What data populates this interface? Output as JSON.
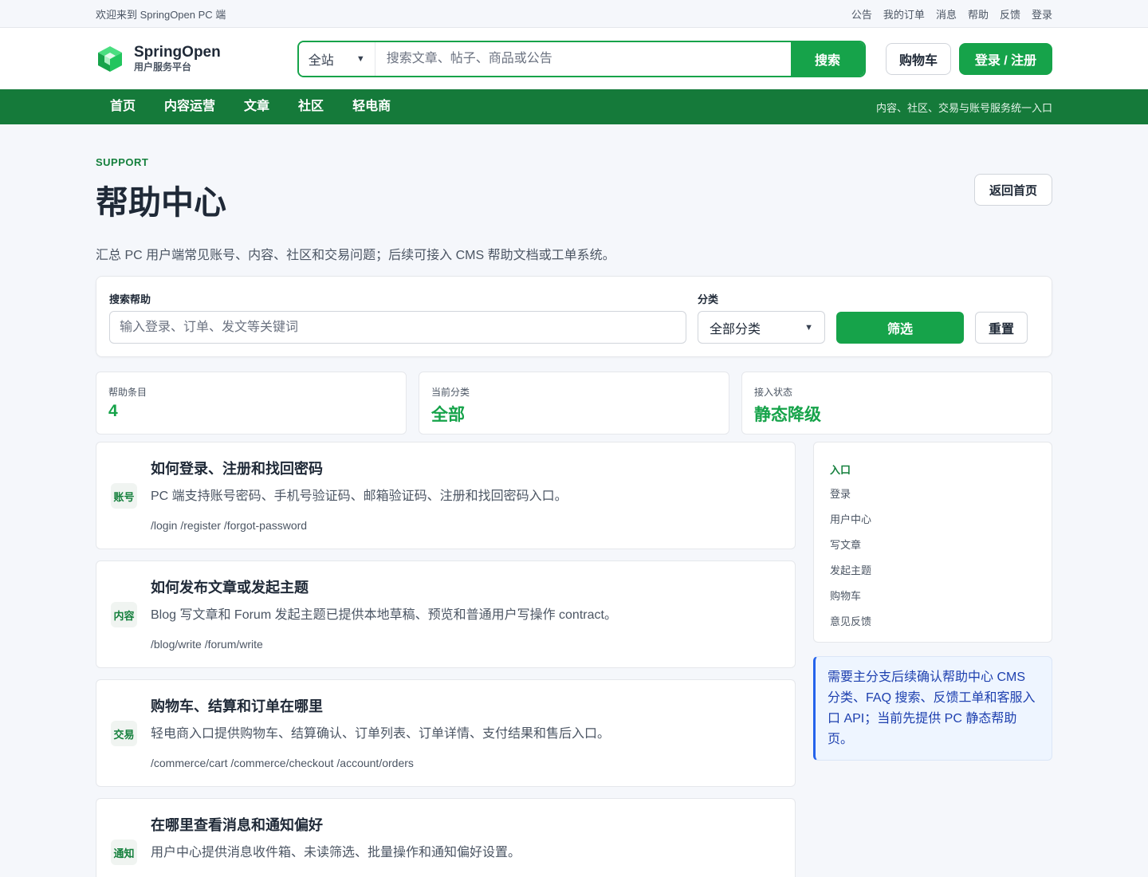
{
  "topbar": {
    "welcome": "欢迎来到 SpringOpen PC 端",
    "links": [
      "公告",
      "我的订单",
      "消息",
      "帮助",
      "反馈",
      "登录"
    ]
  },
  "header": {
    "brand": "SpringOpen",
    "subtitle": "用户服务平台",
    "search_scope": "全站",
    "search_placeholder": "搜索文章、帖子、商品或公告",
    "search_button": "搜索",
    "cart": "购物车",
    "login": "登录 / 注册"
  },
  "nav": {
    "items": [
      "首页",
      "内容运营",
      "文章",
      "社区",
      "轻电商"
    ],
    "slogan": "内容、社区、交易与账号服务统一入口"
  },
  "page": {
    "eyebrow": "SUPPORT",
    "title": "帮助中心",
    "back": "返回首页",
    "desc": "汇总 PC 用户端常见账号、内容、社区和交易问题；后续可接入 CMS 帮助文档或工单系统。"
  },
  "filter": {
    "search_label": "搜索帮助",
    "search_placeholder": "输入登录、订单、发文等关键词",
    "category_label": "分类",
    "category_value": "全部分类",
    "filter_button": "筛选",
    "reset_button": "重置"
  },
  "stats": [
    {
      "label": "帮助条目",
      "value": "4"
    },
    {
      "label": "当前分类",
      "value": "全部"
    },
    {
      "label": "接入状态",
      "value": "静态降级"
    }
  ],
  "items": [
    {
      "badge": "账号",
      "title": "如何登录、注册和找回密码",
      "desc": "PC 端支持账号密码、手机号验证码、邮箱验证码、注册和找回密码入口。",
      "paths": "/login /register /forgot-password"
    },
    {
      "badge": "内容",
      "title": "如何发布文章或发起主题",
      "desc": "Blog 写文章和 Forum 发起主题已提供本地草稿、预览和普通用户写操作 contract。",
      "paths": "/blog/write /forum/write"
    },
    {
      "badge": "交易",
      "title": "购物车、结算和订单在哪里",
      "desc": "轻电商入口提供购物车、结算确认、订单列表、订单详情、支付结果和售后入口。",
      "paths": "/commerce/cart /commerce/checkout /account/orders"
    },
    {
      "badge": "通知",
      "title": "在哪里查看消息和通知偏好",
      "desc": "用户中心提供消息收件箱、未读筛选、批量操作和通知偏好设置。",
      "paths": ""
    }
  ],
  "sidebar": {
    "head": "入口",
    "links": [
      "登录",
      "用户中心",
      "写文章",
      "发起主题",
      "购物车",
      "意见反馈"
    ],
    "notice": "需要主分支后续确认帮助中心 CMS 分类、FAQ 搜索、反馈工单和客服入口 API；当前先提供 PC 静态帮助页。"
  },
  "colors": {
    "primary": "#16a34a",
    "nav_bg": "#157a3a",
    "notice_accent": "#2563eb"
  }
}
